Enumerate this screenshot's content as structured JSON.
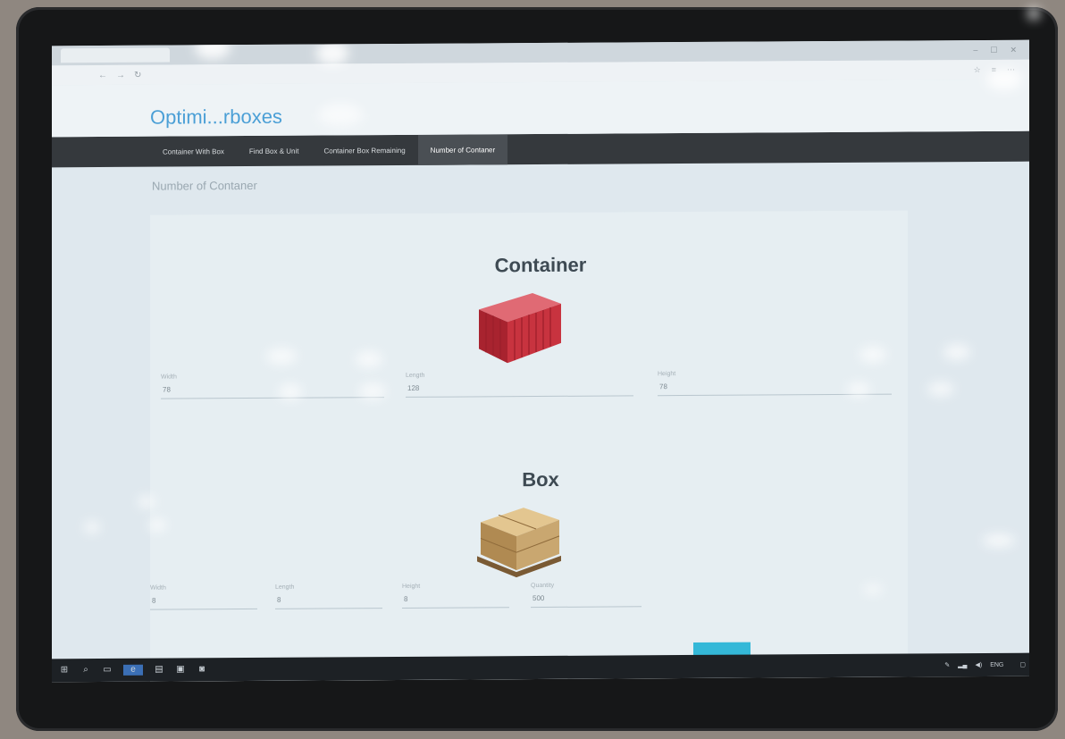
{
  "browser": {
    "tab_title": "",
    "url": "",
    "window_controls": [
      "–",
      "☐",
      "✕"
    ],
    "nav_icons": [
      "back-icon",
      "forward-icon",
      "refresh-icon"
    ]
  },
  "site": {
    "brand": "Optimi...rboxes"
  },
  "nav": {
    "items": [
      {
        "label": "Container With Box",
        "active": false
      },
      {
        "label": "Find Box & Unit",
        "active": false
      },
      {
        "label": "Container Box Remaining",
        "active": false
      },
      {
        "label": "Number of Contaner",
        "active": true
      }
    ]
  },
  "page": {
    "breadcrumb": "Number of Contaner"
  },
  "container_section": {
    "title": "Container",
    "fields": [
      {
        "label": "Width",
        "value": "78",
        "hint": ""
      },
      {
        "label": "Length",
        "value": "128",
        "hint": ""
      },
      {
        "label": "Height",
        "value": "78",
        "hint": ""
      }
    ]
  },
  "box_section": {
    "title": "Box",
    "fields": [
      {
        "label": "Width",
        "value": "8",
        "hint": ""
      },
      {
        "label": "Length",
        "value": "8",
        "hint": ""
      },
      {
        "label": "Height",
        "value": "8",
        "hint": ""
      },
      {
        "label": "Quantity",
        "value": "500",
        "hint": ""
      }
    ],
    "calculate_label": ""
  },
  "taskbar": {
    "tray_text": "",
    "language": "ENG",
    "time": "",
    "date": ""
  },
  "colors": {
    "brand": "#4b9fd6",
    "navbar": "#35393d",
    "accent_button": "#34b8d8",
    "container_red": "#c8333f",
    "box_tan": "#c9a770"
  }
}
